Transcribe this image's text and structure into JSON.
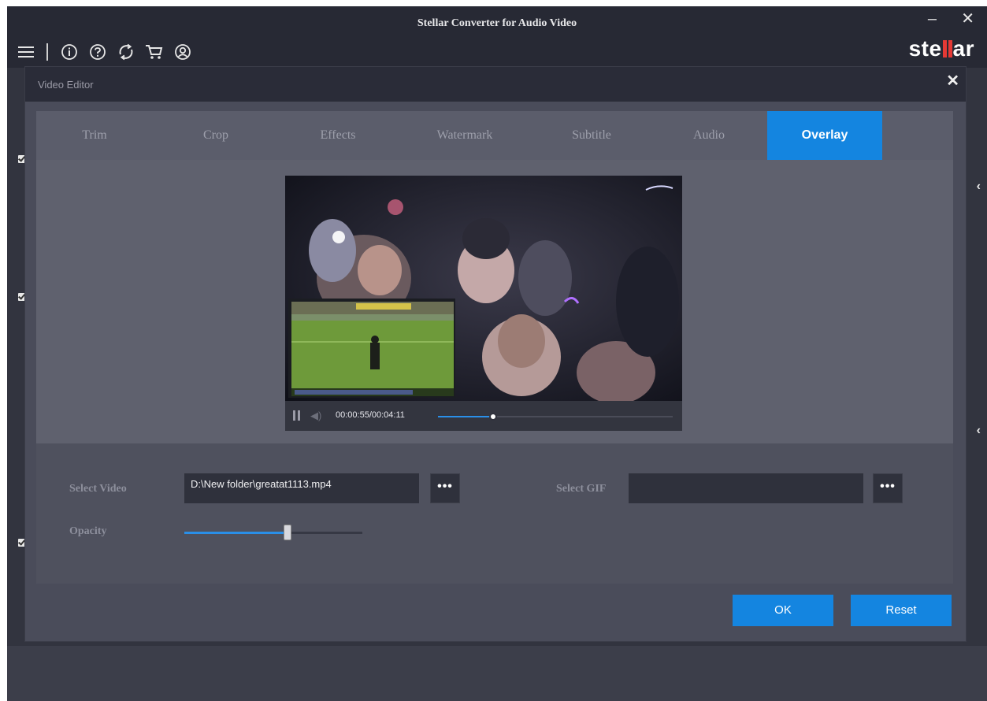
{
  "app": {
    "title": "Stellar Converter for Audio Video",
    "brand_left": "ste",
    "brand_right": "ar",
    "minimize_glyph": "–",
    "close_glyph": "✕",
    "toolbar_icons": [
      "menu-icon",
      "info-icon",
      "help-icon",
      "refresh-icon",
      "cart-icon",
      "account-icon"
    ]
  },
  "dialog": {
    "title": "Video Editor",
    "close_glyph": "✕",
    "tabs": [
      {
        "label": "Trim"
      },
      {
        "label": "Crop"
      },
      {
        "label": "Effects"
      },
      {
        "label": "Watermark"
      },
      {
        "label": "Subtitle"
      },
      {
        "label": "Audio"
      },
      {
        "label": "Overlay",
        "active": true
      }
    ],
    "player": {
      "time": "00:00:55/00:04:11",
      "progress": 0.235
    },
    "overlay": {
      "select_video_label": "Select Video",
      "select_video_value": "D:\\New folder\\greatat1113.mp4",
      "browse_label": "•••",
      "select_gif_label": "Select GIF",
      "select_gif_value": "",
      "opacity_label": "Opacity",
      "opacity_value": 0.58
    },
    "buttons": {
      "ok": "OK",
      "reset": "Reset"
    }
  },
  "colors": {
    "accent": "#1485e0",
    "brand_red": "#e53935"
  }
}
